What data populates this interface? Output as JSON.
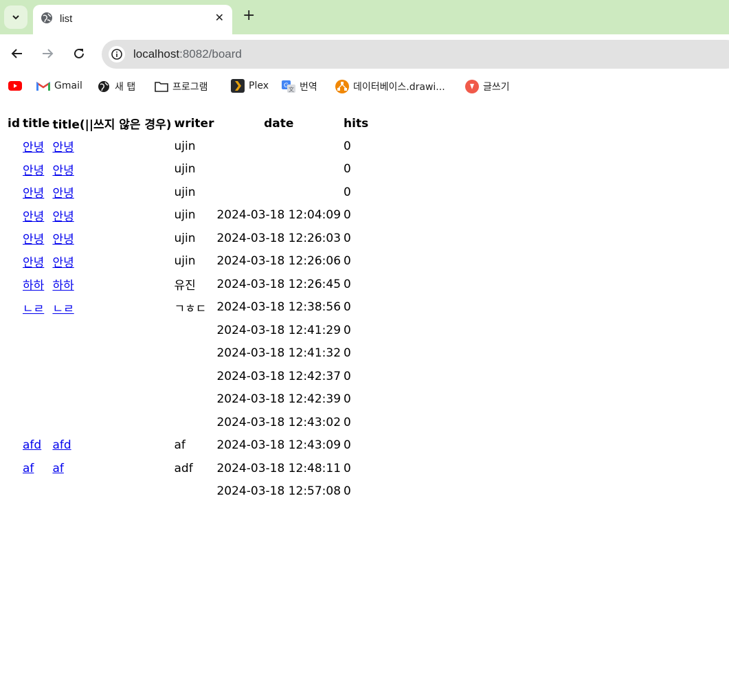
{
  "browser": {
    "tab_title": "list",
    "url_host": "localhost",
    "url_path": ":8082/board",
    "bookmarks": [
      {
        "label": "",
        "icon": "youtube-icon"
      },
      {
        "label": "Gmail",
        "icon": "gmail-icon"
      },
      {
        "label": "새 탭",
        "icon": "globe-icon"
      },
      {
        "label": "프로그램",
        "icon": "folder-icon"
      },
      {
        "label": "Plex",
        "icon": "plex-icon"
      },
      {
        "label": "번역",
        "icon": "translate-icon"
      },
      {
        "label": "데이터베이스.drawi...",
        "icon": "drawio-icon"
      },
      {
        "label": "글쓰기",
        "icon": "pen-icon"
      }
    ]
  },
  "table": {
    "headers": [
      "id",
      "title",
      "title(||쓰지 않은 경우)",
      "writer",
      "date",
      "hits"
    ],
    "rows": [
      {
        "id": "",
        "title": "안녕",
        "title2": "안녕",
        "writer": "ujin",
        "date": "",
        "hits": "0"
      },
      {
        "id": "",
        "title": "안녕",
        "title2": "안녕",
        "writer": "ujin",
        "date": "",
        "hits": "0"
      },
      {
        "id": "",
        "title": "안녕",
        "title2": "안녕",
        "writer": "ujin",
        "date": "",
        "hits": "0"
      },
      {
        "id": "",
        "title": "안녕",
        "title2": "안녕",
        "writer": "ujin",
        "date": "2024-03-18 12:04:09",
        "hits": "0"
      },
      {
        "id": "",
        "title": "안녕",
        "title2": "안녕",
        "writer": "ujin",
        "date": "2024-03-18 12:26:03",
        "hits": "0"
      },
      {
        "id": "",
        "title": "안녕",
        "title2": "안녕",
        "writer": "ujin",
        "date": "2024-03-18 12:26:06",
        "hits": "0"
      },
      {
        "id": "",
        "title": "하하",
        "title2": "하하",
        "writer": "유진",
        "date": "2024-03-18 12:26:45",
        "hits": "0"
      },
      {
        "id": "",
        "title": "ㄴㄹ",
        "title2": "ㄴㄹ",
        "writer": "ㄱㅎㄷ",
        "date": "2024-03-18 12:38:56",
        "hits": "0"
      },
      {
        "id": "",
        "title": "",
        "title2": "",
        "writer": "",
        "date": "2024-03-18 12:41:29",
        "hits": "0"
      },
      {
        "id": "",
        "title": "",
        "title2": "",
        "writer": "",
        "date": "2024-03-18 12:41:32",
        "hits": "0"
      },
      {
        "id": "",
        "title": "",
        "title2": "",
        "writer": "",
        "date": "2024-03-18 12:42:37",
        "hits": "0"
      },
      {
        "id": "",
        "title": "",
        "title2": "",
        "writer": "",
        "date": "2024-03-18 12:42:39",
        "hits": "0"
      },
      {
        "id": "",
        "title": "",
        "title2": "",
        "writer": "",
        "date": "2024-03-18 12:43:02",
        "hits": "0"
      },
      {
        "id": "",
        "title": "afd",
        "title2": "afd",
        "writer": "af",
        "date": "2024-03-18 12:43:09",
        "hits": "0"
      },
      {
        "id": "",
        "title": "af",
        "title2": "af",
        "writer": "adf",
        "date": "2024-03-18 12:48:11",
        "hits": "0"
      },
      {
        "id": "",
        "title": "",
        "title2": "",
        "writer": "",
        "date": "2024-03-18 12:57:08",
        "hits": "0"
      }
    ]
  }
}
